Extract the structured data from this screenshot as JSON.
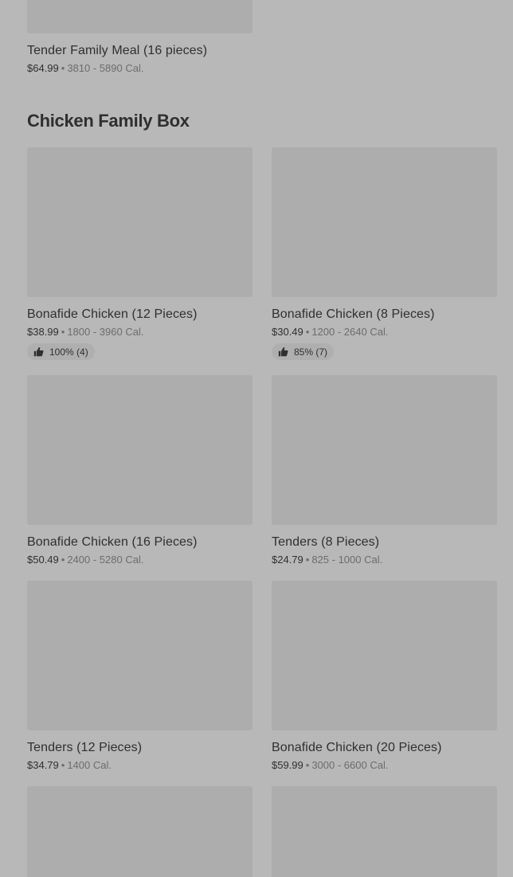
{
  "top_item": {
    "name": "Tender Family Meal (16 pieces)",
    "price": "$64.99",
    "calories": "3810 - 5890 Cal."
  },
  "section": {
    "title": "Chicken Family Box",
    "items": [
      {
        "name": "Bonafide Chicken (12 Pieces)",
        "price": "$38.99",
        "calories": "1800 - 3960 Cal.",
        "rating": "100% (4)"
      },
      {
        "name": "Bonafide Chicken (8 Pieces)",
        "price": "$30.49",
        "calories": "1200 - 2640 Cal.",
        "rating": "85% (7)"
      },
      {
        "name": "Bonafide Chicken (16 Pieces)",
        "price": "$50.49",
        "calories": "2400 - 5280 Cal."
      },
      {
        "name": "Tenders (8 Pieces)",
        "price": "$24.79",
        "calories": "825 - 1000 Cal."
      },
      {
        "name": "Tenders (12 Pieces)",
        "price": "$34.79",
        "calories": "1400 Cal."
      },
      {
        "name": "Bonafide Chicken (20 Pieces)",
        "price": "$59.99",
        "calories": "3000 - 6600 Cal."
      }
    ]
  },
  "separator": "•",
  "icons": {
    "rating": "thumbs-up-icon"
  },
  "colors": {
    "background": "#b8b8b8",
    "image_placeholder": "#adadad",
    "text_primary": "#2f2f2f",
    "text_secondary": "#6c6c6c"
  }
}
